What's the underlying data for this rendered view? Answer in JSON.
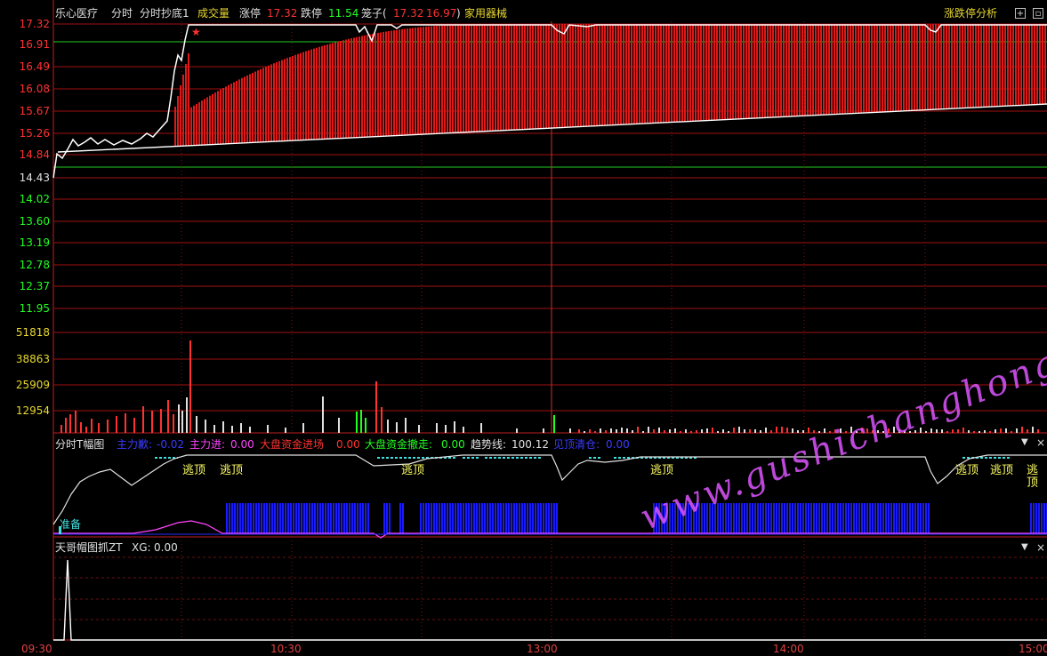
{
  "header": {
    "stock_name": "乐心医疗",
    "mode": "分时",
    "indicator": "分时抄底1",
    "volume_label": "成交量",
    "limit_up_label": "涨停",
    "limit_up_value": "17.32",
    "limit_down_label": "跌停",
    "limit_down_value": "11.54",
    "cage_label": "笼子(",
    "cage_high": "17.32",
    "cage_low": "16.97",
    "cage_close": ")",
    "sector": "家用器械",
    "analysis_button": "涨跌停分析"
  },
  "price_axis": [
    "17.32",
    "16.91",
    "16.49",
    "16.08",
    "15.67",
    "15.26",
    "14.84",
    "14.43",
    "14.02",
    "13.60",
    "13.19",
    "12.78",
    "12.37",
    "11.95"
  ],
  "volume_axis": [
    "51818",
    "38863",
    "25909",
    "12954"
  ],
  "time_axis": [
    "09:30",
    "10:30",
    "13:00",
    "14:00",
    "15:00"
  ],
  "indicator_bar": {
    "name": "分时T幅图",
    "main_buy_label": "主力歉:",
    "main_buy_value": "-0.02",
    "main_in_label": "主力进:",
    "main_in_value": "0.00",
    "big_in_label": "大盘资金进场",
    "big_in_value": "0.00",
    "big_out_label": "大盘资金撤走:",
    "big_out_value": "0.00",
    "trend_label": "趋势线:",
    "trend_value": "100.12",
    "clear_label": "见顶清仓:",
    "clear_value": "0.00"
  },
  "signals": [
    "逃顶",
    "逃顶",
    "逃顶",
    "逃顶",
    "逃顶",
    "逃顶",
    "逃顶"
  ],
  "prep_label": "准备",
  "lower_panel": {
    "name": "天哥帽图抓ZT",
    "xg_label": "XG:",
    "xg_value": "0.00"
  },
  "watermark": "www.gushichanghong.com",
  "colors": {
    "up": "#ff3232",
    "down": "#22ff22",
    "grid": "#a01010",
    "yellow": "#e8d830",
    "blue": "#1a1aff",
    "cyan": "#40e0e0",
    "magenta": "#ff44ff"
  }
}
